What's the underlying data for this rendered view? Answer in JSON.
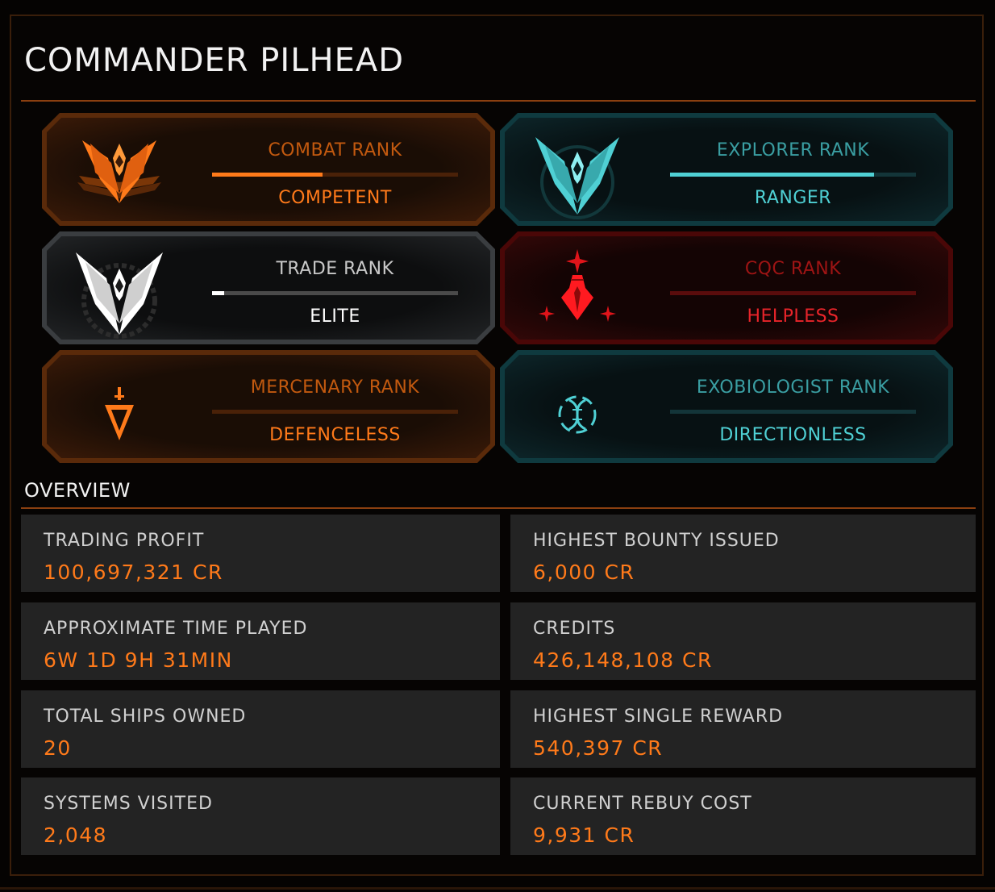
{
  "commander": {
    "name": "COMMANDER PILHEAD"
  },
  "colors": {
    "orange": "#ff7a1a",
    "teal": "#4fd0d4",
    "red": "#e0141a",
    "white": "#f2f2f2"
  },
  "ranks": [
    {
      "label": "COMBAT RANK",
      "value": "COMPETENT",
      "progress": 0.45,
      "theme": "orange",
      "icon": "combat-rank-wings-icon"
    },
    {
      "label": "EXPLORER RANK",
      "value": "RANGER",
      "progress": 0.83,
      "theme": "teal",
      "icon": "explorer-rank-wings-icon"
    },
    {
      "label": "TRADE RANK",
      "value": "ELITE",
      "progress": 0.05,
      "theme": "grey",
      "icon": "trade-rank-elite-wings-icon"
    },
    {
      "label": "CQC RANK",
      "value": "HELPLESS",
      "progress": 0.0,
      "theme": "red",
      "icon": "cqc-rank-icon"
    },
    {
      "label": "MERCENARY RANK",
      "value": "DEFENCELESS",
      "progress": 0.0,
      "theme": "orange",
      "icon": "mercenary-rank-dagger-icon"
    },
    {
      "label": "EXOBIOLOGIST RANK",
      "value": "DIRECTIONLESS",
      "progress": 0.0,
      "theme": "teal",
      "icon": "exobiologist-rank-dna-icon"
    }
  ],
  "overview": {
    "title": "OVERVIEW",
    "stats": [
      {
        "label": "TRADING PROFIT",
        "value": "100,697,321 CR"
      },
      {
        "label": "HIGHEST BOUNTY ISSUED",
        "value": "6,000 CR"
      },
      {
        "label": "APPROXIMATE TIME PLAYED",
        "value": "6W 1D 9H 31MIN"
      },
      {
        "label": "CREDITS",
        "value": "426,148,108 CR"
      },
      {
        "label": "TOTAL SHIPS OWNED",
        "value": "20"
      },
      {
        "label": "HIGHEST SINGLE REWARD",
        "value": "540,397 CR"
      },
      {
        "label": "SYSTEMS VISITED",
        "value": "2,048"
      },
      {
        "label": "CURRENT REBUY COST",
        "value": "9,931 CR"
      }
    ]
  }
}
